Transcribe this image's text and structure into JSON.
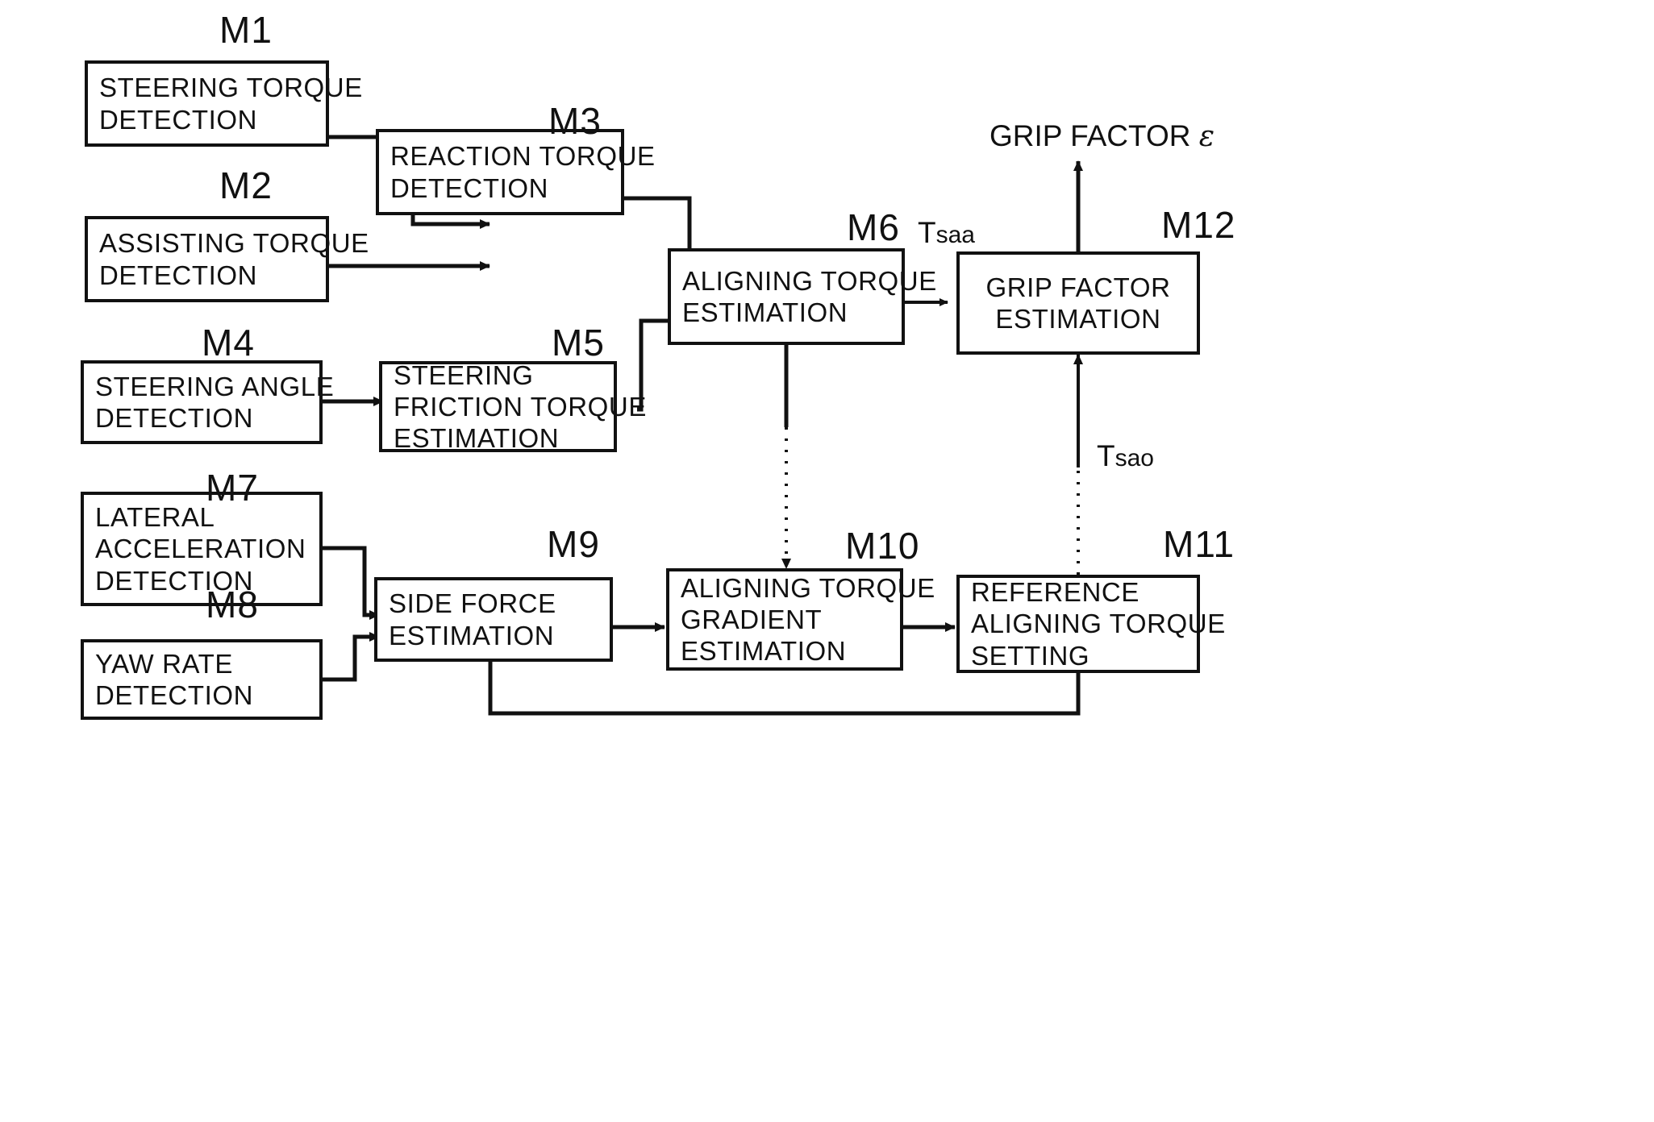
{
  "diagram": {
    "title": "Grip factor estimation block diagram",
    "line_color": "#111111",
    "background": "#ffffff",
    "blocks": [
      {
        "id": "M1",
        "tag": "M1",
        "lines": [
          "STEERING TORQUE",
          "DETECTION"
        ]
      },
      {
        "id": "M2",
        "tag": "M2",
        "lines": [
          "ASSISTING TORQUE",
          "DETECTION"
        ]
      },
      {
        "id": "M3",
        "tag": "M3",
        "lines": [
          "REACTION TORQUE",
          "DETECTION"
        ]
      },
      {
        "id": "M4",
        "tag": "M4",
        "lines": [
          "STEERING ANGLE",
          "DETECTION"
        ]
      },
      {
        "id": "M5",
        "tag": "M5",
        "lines": [
          "STEERING",
          "FRICTION TORQUE",
          "ESTIMATION"
        ]
      },
      {
        "id": "M6",
        "tag": "M6",
        "lines": [
          "ALIGNING TORQUE",
          "ESTIMATION"
        ]
      },
      {
        "id": "M7",
        "tag": "M7",
        "lines": [
          "LATERAL",
          "ACCELERATION",
          "DETECTION"
        ]
      },
      {
        "id": "M8",
        "tag": "M8",
        "lines": [
          "YAW RATE",
          "DETECTION"
        ]
      },
      {
        "id": "M9",
        "tag": "M9",
        "lines": [
          "SIDE FORCE",
          "ESTIMATION"
        ]
      },
      {
        "id": "M10",
        "tag": "M10",
        "lines": [
          "ALIGNING TORQUE",
          "GRADIENT",
          "ESTIMATION"
        ]
      },
      {
        "id": "M11",
        "tag": "M11",
        "lines": [
          "REFERENCE",
          "ALIGNING TORQUE",
          "SETTING"
        ]
      },
      {
        "id": "M12",
        "tag": "M12",
        "lines": [
          "GRIP FACTOR",
          "ESTIMATION"
        ]
      }
    ],
    "signals": [
      {
        "id": "Tsaa",
        "base": "T",
        "sub": "saa",
        "from": "M6",
        "to": "M12"
      },
      {
        "id": "Tsao",
        "base": "T",
        "sub": "sao",
        "from": "M11",
        "to": "M12"
      }
    ],
    "outputs": [
      {
        "id": "grip-factor",
        "text": "GRIP FACTOR ",
        "symbol": "ε",
        "from": "M12"
      }
    ]
  }
}
